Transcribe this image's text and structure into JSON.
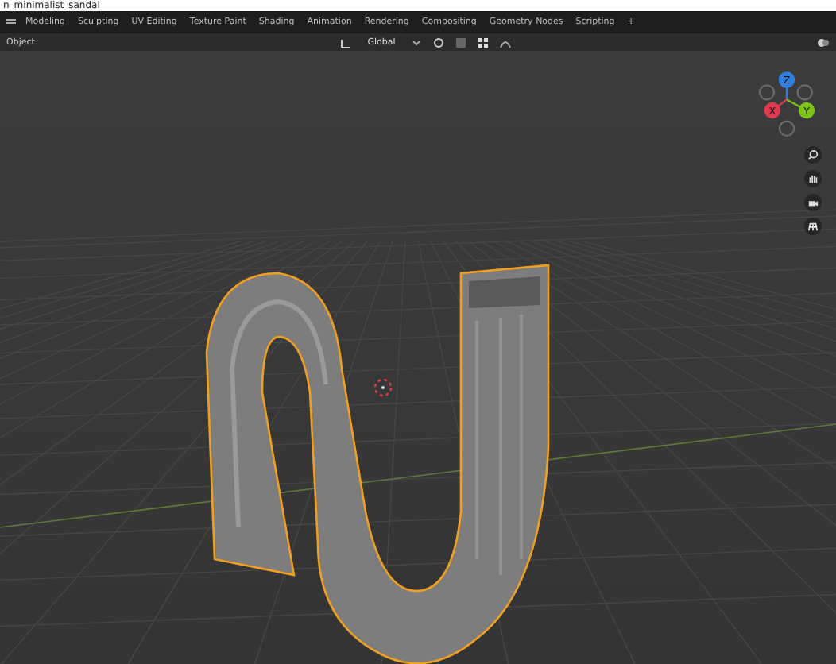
{
  "title_bar": {
    "title": "n_minimalist_sandal"
  },
  "workspace_tabs": [
    {
      "label": "Modeling",
      "selected": false
    },
    {
      "label": "Sculpting",
      "selected": false
    },
    {
      "label": "UV Editing",
      "selected": false
    },
    {
      "label": "Texture Paint",
      "selected": false
    },
    {
      "label": "Shading",
      "selected": false
    },
    {
      "label": "Animation",
      "selected": false
    },
    {
      "label": "Rendering",
      "selected": false
    },
    {
      "label": "Compositing",
      "selected": false
    },
    {
      "label": "Geometry Nodes",
      "selected": false
    },
    {
      "label": "Scripting",
      "selected": false
    },
    {
      "label": "+",
      "selected": false
    }
  ],
  "header": {
    "menu": "Object",
    "orientation": "Global"
  },
  "gizmo": {
    "axes": [
      {
        "label": "Z",
        "color": "#2f7fe0"
      },
      {
        "label": "X",
        "color": "#e03a4e"
      },
      {
        "label": "Y",
        "color": "#7ec417"
      }
    ]
  }
}
